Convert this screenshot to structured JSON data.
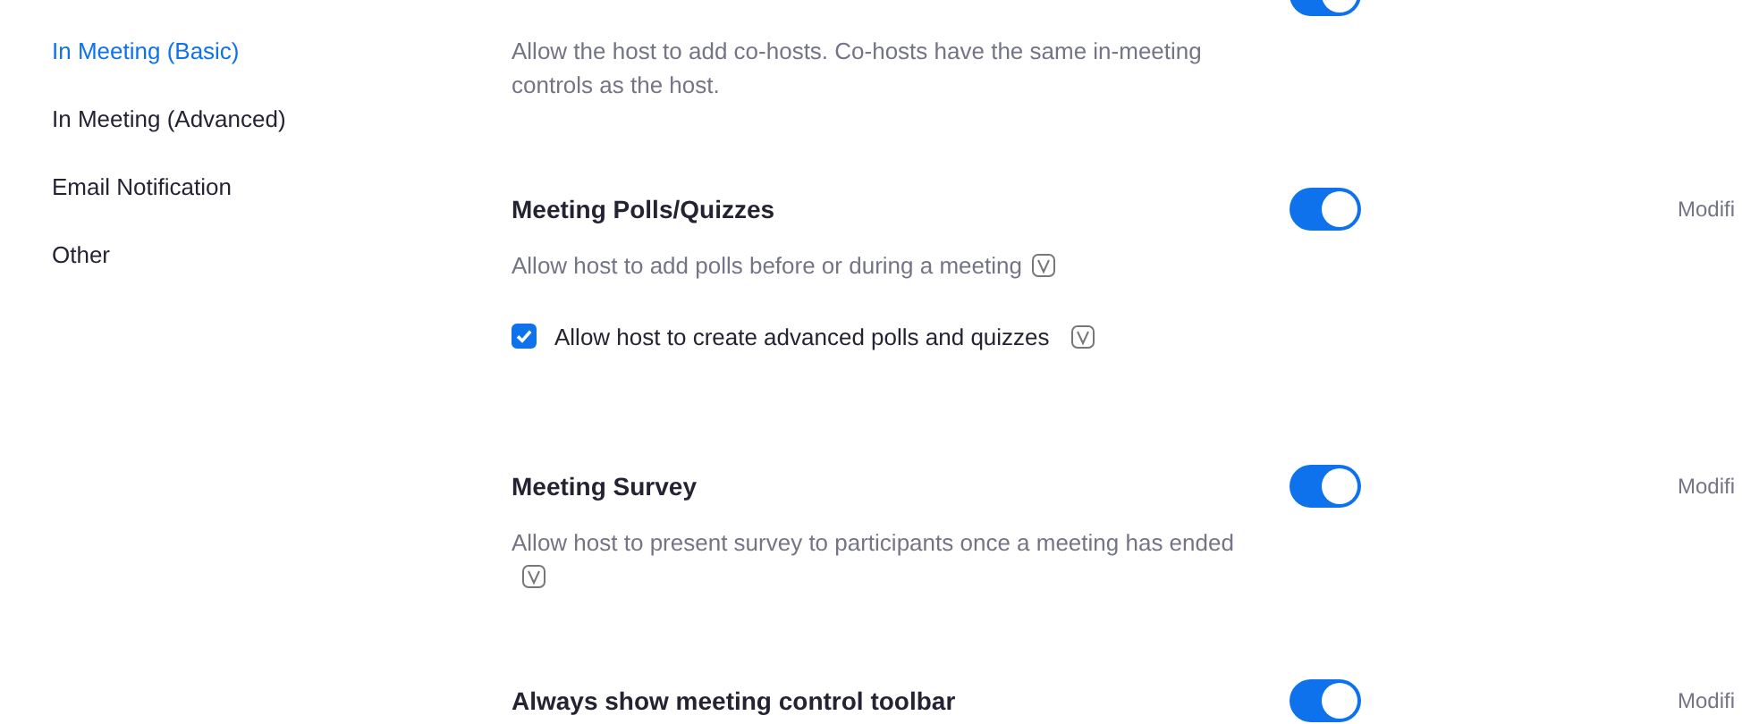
{
  "sidebar": {
    "items": [
      {
        "label": "In Meeting (Basic)",
        "selected": true
      },
      {
        "label": "In Meeting (Advanced)",
        "selected": false
      },
      {
        "label": "Email Notification",
        "selected": false
      },
      {
        "label": "Other",
        "selected": false
      }
    ]
  },
  "settings": [
    {
      "on": true,
      "description": "Allow the host to add co-hosts. Co-hosts have the same in-meeting controls as the host."
    },
    {
      "title": "Meeting Polls/Quizzes",
      "on": true,
      "description": "Allow host to add polls before or during a meeting",
      "description_icon": true,
      "modify_link": "Modifi",
      "options": [
        {
          "label": "Allow host to create advanced polls and quizzes",
          "checked": true,
          "icon": true
        }
      ]
    },
    {
      "title": "Meeting Survey",
      "on": true,
      "description": "Allow host to present survey to participants once a meeting has ended",
      "description_icon": true,
      "modify_link": "Modifi"
    },
    {
      "title": "Always show meeting control toolbar",
      "on": true,
      "modify_link": "Modifi"
    }
  ]
}
